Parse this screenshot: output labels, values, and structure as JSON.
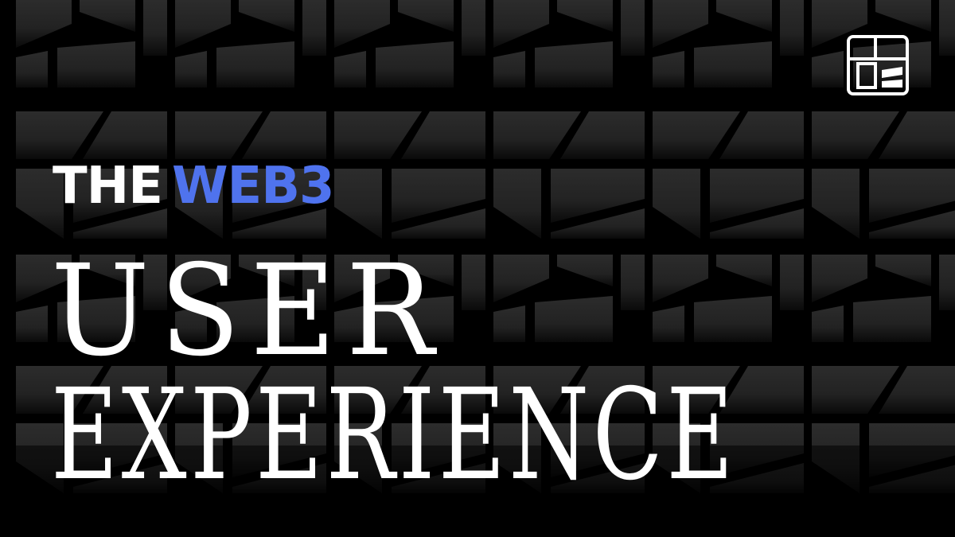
{
  "graphic": {
    "background_color": "#000000",
    "pattern_fill": "#262626",
    "pattern_fill_light": "#343434",
    "brand_color": "#ffffff",
    "logo_icon": "window-frame-logo-icon"
  },
  "headline": {
    "the": "THE",
    "web3": "WEB3",
    "web3_color": "#4f73ee",
    "line2": "USER",
    "line3": "EXPERIENCE"
  }
}
